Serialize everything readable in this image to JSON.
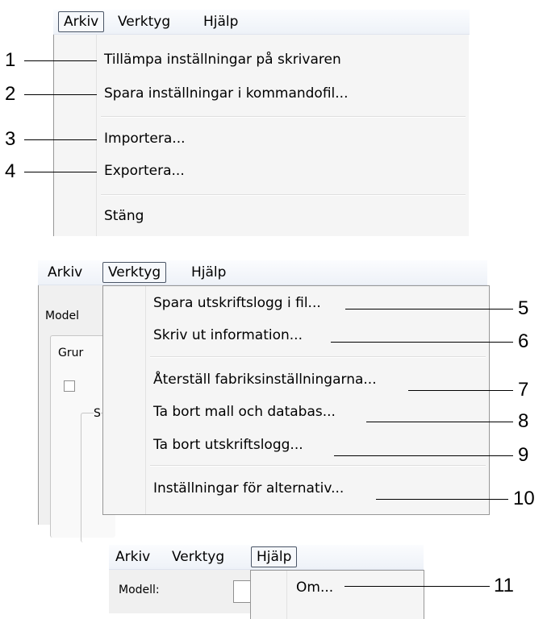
{
  "panel1": {
    "menubar": [
      "Arkiv",
      "Verktyg",
      "Hjälp"
    ],
    "items": [
      {
        "label": "Tillämpa inställningar på skrivaren",
        "callout": "1"
      },
      {
        "label": "Spara inställningar i kommandofil...",
        "callout": "2"
      },
      {
        "label": "Importera...",
        "callout": "3"
      },
      {
        "label": "Exportera...",
        "callout": "4"
      },
      {
        "label": "Stäng",
        "callout": ""
      }
    ]
  },
  "panel2": {
    "menubar": [
      "Arkiv",
      "Verktyg",
      "Hjälp"
    ],
    "background_labels": [
      "Model",
      "Grur",
      "S"
    ],
    "items": [
      {
        "label": "Spara utskriftslogg i fil...",
        "callout": "5"
      },
      {
        "label": "Skriv ut information...",
        "callout": "6"
      },
      {
        "label": "Återställ fabriksinställningarna...",
        "callout": "7"
      },
      {
        "label": "Ta bort mall och databas...",
        "callout": "8"
      },
      {
        "label": "Ta bort utskriftslogg...",
        "callout": "9"
      },
      {
        "label": "Inställningar för alternativ...",
        "callout": "10"
      }
    ]
  },
  "panel3": {
    "menubar": [
      "Arkiv",
      "Verktyg",
      "Hjälp"
    ],
    "background_labels": [
      "Modell:"
    ],
    "items": [
      {
        "label": "Om...",
        "callout": "11"
      }
    ]
  }
}
